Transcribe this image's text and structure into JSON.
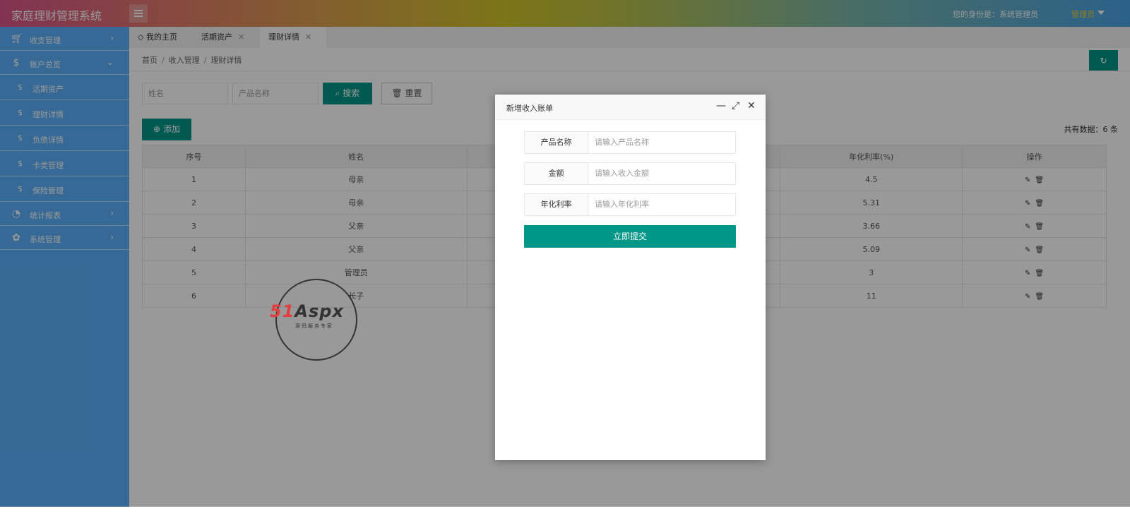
{
  "header": {
    "title": "家庭理财管理系统",
    "identity": "您的身份是：系统管理员",
    "role": "管理员"
  },
  "sidebar": {
    "items": [
      {
        "icon": "cart-icon",
        "label": "收支管理"
      },
      {
        "icon": "dollar-icon",
        "label": "账户总览"
      },
      {
        "icon": "chart-icon",
        "label": "统计报表"
      },
      {
        "icon": "grid-icon",
        "label": "系统管理"
      }
    ],
    "subitems": [
      "活期资产",
      "理财详情",
      "负债详情",
      "卡类管理",
      "保险管理"
    ]
  },
  "tabs": [
    {
      "label": "我的主页"
    },
    {
      "label": "活期资产"
    },
    {
      "label": "理财详情"
    }
  ],
  "breadcrumb": [
    "首页",
    "收入管理",
    "理财详情"
  ],
  "search": {
    "name_placeholder": "姓名",
    "product_placeholder": "产品名称",
    "search_label": "搜索",
    "reset_label": "重置"
  },
  "toolbar": {
    "add_label": "添加",
    "total_text": "共有数据：6 条"
  },
  "table": {
    "headers": [
      "序号",
      "姓名",
      "",
      "",
      "年化利率(%)",
      "操作"
    ],
    "rows": [
      [
        "1",
        "母亲",
        "4.5"
      ],
      [
        "2",
        "母亲",
        "5.31"
      ],
      [
        "3",
        "父亲",
        "3.66"
      ],
      [
        "4",
        "父亲",
        "5.09"
      ],
      [
        "5",
        "管理员",
        "3"
      ],
      [
        "6",
        "长子",
        "11"
      ]
    ]
  },
  "watermark": {
    "text_red": "51",
    "text_dark": "Aspx",
    "subtitle": "源码服务专家"
  },
  "modal": {
    "title": "新增收入账单",
    "fields": [
      {
        "label": "产品名称",
        "placeholder": "请输入产品名称"
      },
      {
        "label": "金额",
        "placeholder": "请输入收入金额"
      },
      {
        "label": "年化利率",
        "placeholder": "请输入年化利率"
      }
    ],
    "submit_label": "立即提交"
  },
  "colors": {
    "primary": "#009688",
    "sidebar": "#5ab0f8",
    "role_text": "#f6d43a"
  }
}
